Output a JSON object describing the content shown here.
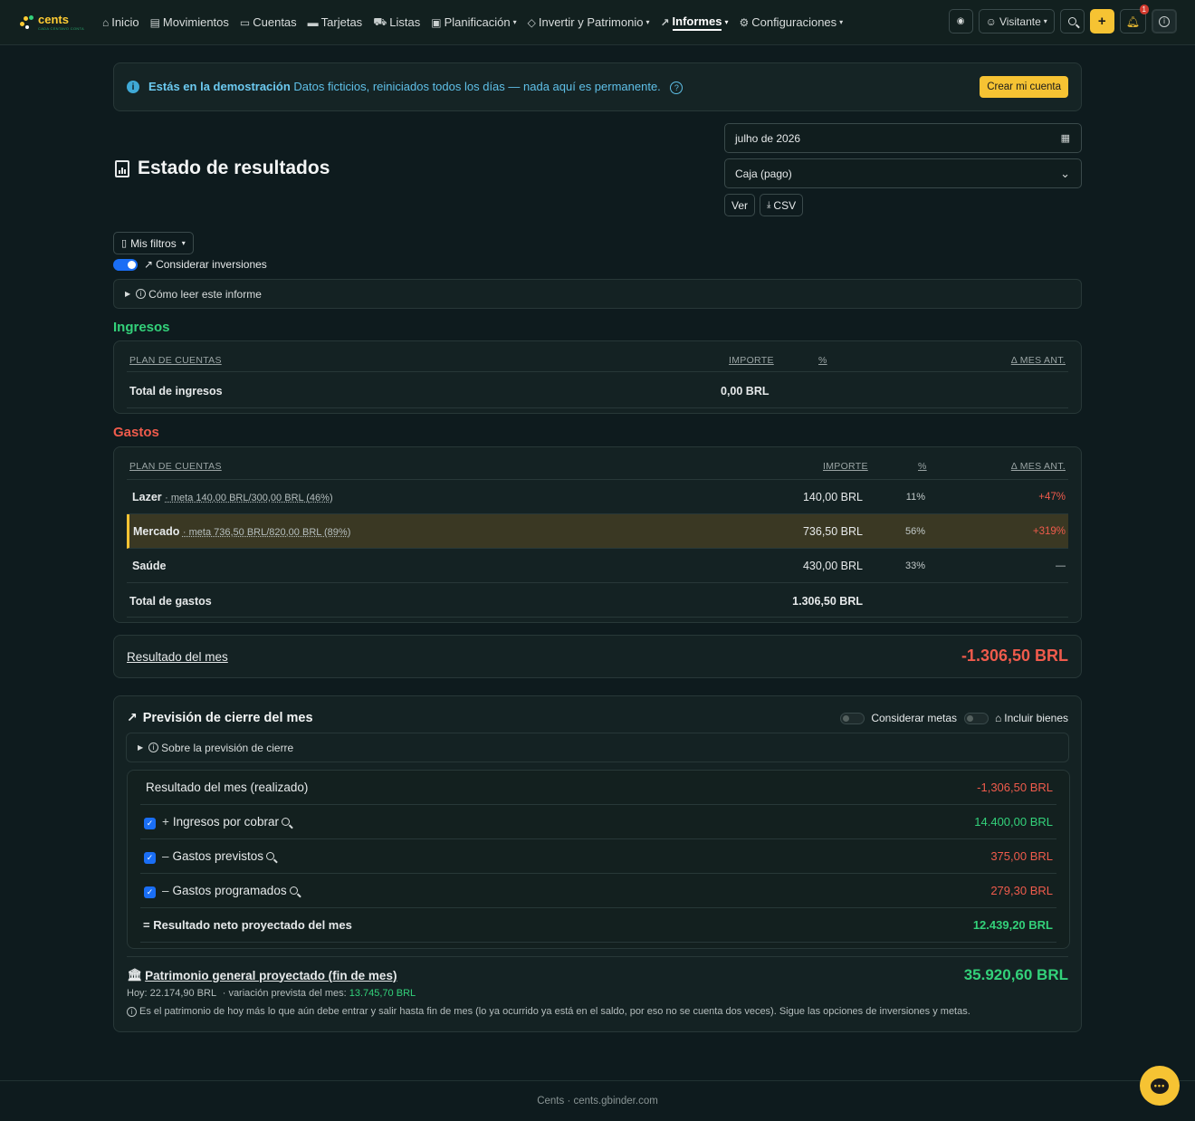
{
  "brand": {
    "name": "cents",
    "tagline": "CADA CENTAVO CONTA"
  },
  "nav": {
    "items": [
      {
        "label": "Inicio",
        "icon": "home-icon",
        "glyph": "⌂"
      },
      {
        "label": "Movimientos",
        "icon": "list-icon",
        "glyph": "▤"
      },
      {
        "label": "Cuentas",
        "icon": "wallet-icon",
        "glyph": "▭"
      },
      {
        "label": "Tarjetas",
        "icon": "credit-card-icon",
        "glyph": "▬"
      },
      {
        "label": "Listas",
        "icon": "cart-icon",
        "glyph": "⛟"
      },
      {
        "label": "Planificación",
        "icon": "calendar-check-icon",
        "glyph": "▣",
        "dropdown": true
      },
      {
        "label": "Invertir y Patrimonio",
        "icon": "gem-icon",
        "glyph": "◇",
        "dropdown": true
      },
      {
        "label": "Informes",
        "icon": "chart-line-icon",
        "glyph": "↗",
        "dropdown": true,
        "active": true
      },
      {
        "label": "Configuraciones",
        "icon": "gear-icon",
        "glyph": "⚙",
        "dropdown": true
      }
    ],
    "user_label": "Visitante",
    "notification_count": "1",
    "add_label": "+"
  },
  "demo": {
    "bold": "Estás en la demostración",
    "text": "Datos ficticios, reiniciados todos los días — nada aquí es permanente.",
    "cta": "Crear mi cuenta"
  },
  "page": {
    "title": "Estado de resultados",
    "month": "julho de 2026",
    "basis": "Caja (pago)",
    "view_btn": "Ver",
    "csv_btn": "CSV",
    "filters_btn": "Mis filtros",
    "toggle_investments": "Considerar inversiones",
    "how_to_read": "Cómo leer este informe"
  },
  "income": {
    "title": "Ingresos",
    "headers": {
      "account": "PLAN DE CUENTAS",
      "amount": "IMPORTE",
      "pct": "%",
      "delta": "Δ MES ANT."
    },
    "total_label": "Total de ingresos",
    "total_value": "0,00 BRL"
  },
  "expenses": {
    "title": "Gastos",
    "headers": {
      "account": "PLAN DE CUENTAS",
      "amount": "IMPORTE",
      "pct": "%",
      "delta": "Δ MES ANT."
    },
    "rows": [
      {
        "name": "Lazer",
        "meta": "· meta 140,00 BRL/300,00 BRL (46%)",
        "amount": "140,00 BRL",
        "pct": "11%",
        "delta": "+47%"
      },
      {
        "name": "Mercado",
        "meta": "· meta 736,50 BRL/820,00 BRL (89%)",
        "amount": "736,50 BRL",
        "pct": "56%",
        "delta": "+319%"
      },
      {
        "name": "Saúde",
        "meta": "",
        "amount": "430,00 BRL",
        "pct": "33%",
        "delta": "—"
      }
    ],
    "total_label": "Total de gastos",
    "total_value": "1.306,50 BRL"
  },
  "result": {
    "label": "Resultado del mes",
    "value": "-1.306,50 BRL"
  },
  "forecast": {
    "title": "Previsión de cierre del mes",
    "toggle_goals": "Considerar metas",
    "toggle_assets": "Incluir bienes",
    "about": "Sobre la previsión de cierre",
    "realized_label": "Resultado del mes (realizado)",
    "realized_value": "-1,306,50 BRL",
    "rows": [
      {
        "sign": "+",
        "label": "Ingresos por cobrar",
        "value": "14.400,00 BRL",
        "color": "#33d17a"
      },
      {
        "sign": "–",
        "label": "Gastos previstos",
        "value": "375,00 BRL",
        "color": "#ef5b4c"
      },
      {
        "sign": "–",
        "label": "Gastos programados",
        "value": "279,30 BRL",
        "color": "#ef5b4c"
      }
    ],
    "net_label": "= Resultado neto proyectado del mes",
    "net_value": "12.439,20 BRL",
    "patrimony_label": "Patrimonio general proyectado (fin de mes)",
    "patrimony_value": "35.920,60 BRL",
    "today_text": "Hoy: 22.174,90 BRL",
    "variation_text": "· variación prevista del mes:",
    "variation_value": "13.745,70 BRL",
    "note": "Es el patrimonio de hoy más lo que aún debe entrar y salir hasta fin de mes (lo ya ocurrido ya está en el saldo, por eso no se cuenta dos veces). Sigue las opciones de inversiones y metas."
  },
  "footer": {
    "text": "Cents · cents.gbinder.com"
  }
}
